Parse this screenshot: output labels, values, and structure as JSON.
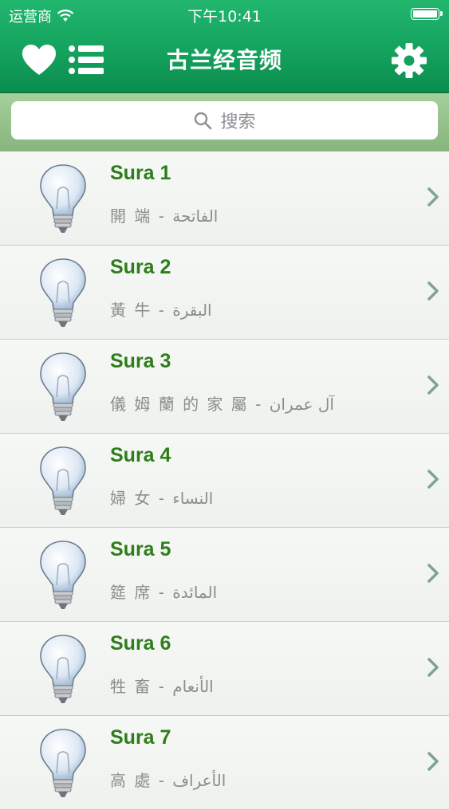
{
  "status": {
    "carrier": "运营商",
    "time": "下午10:41"
  },
  "nav": {
    "title": "古兰经音频"
  },
  "search": {
    "placeholder": "搜索"
  },
  "suras": [
    {
      "title": "Sura 1",
      "subtitle": "開 端 - الفاتحة"
    },
    {
      "title": "Sura 2",
      "subtitle": "黃 牛 - البقرة"
    },
    {
      "title": "Sura 3",
      "subtitle": "儀 姆 蘭 的 家 屬 - آل عمران"
    },
    {
      "title": "Sura 4",
      "subtitle": "婦 女 - النساء"
    },
    {
      "title": "Sura 5",
      "subtitle": "筵 席 - المائدة"
    },
    {
      "title": "Sura 6",
      "subtitle": "牲 畜 - الأنعام"
    },
    {
      "title": "Sura 7",
      "subtitle": "高 處 - الأعراف"
    }
  ],
  "icons": {
    "favorites": "heart-icon",
    "list": "list-icon",
    "settings": "gear-icon",
    "search": "search-icon",
    "row": "lightbulb-icon",
    "disclosure": "chevron-right-icon"
  },
  "colors": {
    "header_green": "#14a35e",
    "title_green": "#2e7d1a",
    "search_band": "#97c48c"
  }
}
